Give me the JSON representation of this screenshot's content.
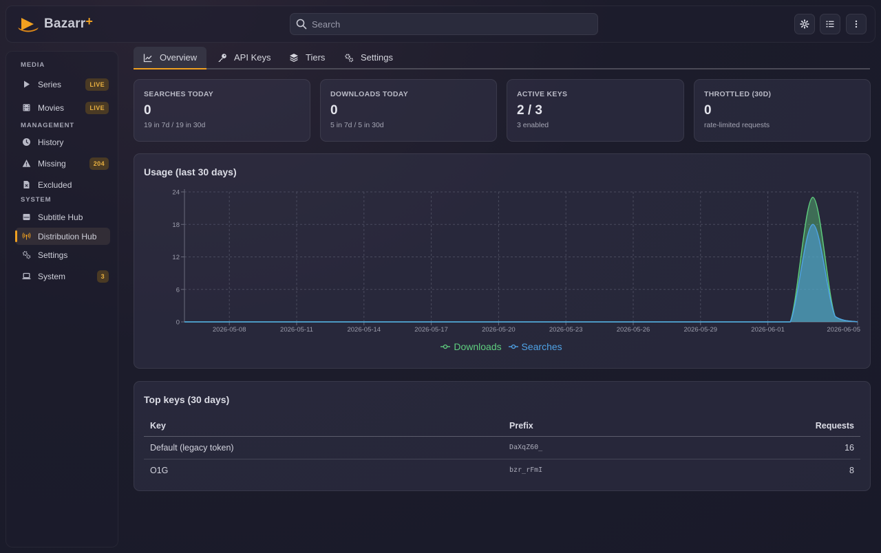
{
  "app": {
    "name": "Bazarr",
    "plus": "+"
  },
  "search": {
    "placeholder": "Search"
  },
  "toolbar": {
    "icons": [
      "settings-icon",
      "list-icon",
      "more-vertical-icon"
    ]
  },
  "sidebar": {
    "sections": [
      {
        "title": "MEDIA"
      },
      {
        "title": "MANAGEMENT"
      },
      {
        "title": "SYSTEM"
      }
    ],
    "items": [
      {
        "label": "Series",
        "icon": "play-icon",
        "badge": "LIVE"
      },
      {
        "label": "Movies",
        "icon": "film-icon",
        "badge": "LIVE"
      },
      {
        "label": "History",
        "icon": "clock-icon",
        "badge": ""
      },
      {
        "label": "Missing",
        "icon": "warning-icon",
        "badge": "204"
      },
      {
        "label": "Excluded",
        "icon": "file-excluded-icon",
        "badge": ""
      },
      {
        "label": "Subtitle Hub",
        "icon": "inbox-icon",
        "badge": ""
      },
      {
        "label": "Distribution Hub",
        "icon": "broadcast-icon",
        "badge": "",
        "active": true
      },
      {
        "label": "Settings",
        "icon": "cogs-icon",
        "badge": ""
      },
      {
        "label": "System",
        "icon": "laptop-icon",
        "badge": "3"
      }
    ]
  },
  "tabs": [
    {
      "label": "Overview",
      "icon": "chart-line-icon",
      "active": true
    },
    {
      "label": "API Keys",
      "icon": "key-icon"
    },
    {
      "label": "Tiers",
      "icon": "layers-icon"
    },
    {
      "label": "Settings",
      "icon": "cogs-icon"
    }
  ],
  "stats": [
    {
      "label": "SEARCHES TODAY",
      "value": "0",
      "sub": "19 in 7d / 19 in 30d"
    },
    {
      "label": "DOWNLOADS TODAY",
      "value": "0",
      "sub": "5 in 7d / 5 in 30d"
    },
    {
      "label": "ACTIVE KEYS",
      "value": "2 / 3",
      "sub": "3 enabled"
    },
    {
      "label": "THROTTLED (30D)",
      "value": "0",
      "sub": "rate-limited requests"
    }
  ],
  "usage_title": "Usage (last 30 days)",
  "colors": {
    "accent": "#f0a020",
    "downloads": "#5fcf7f",
    "searches": "#4fa3e6"
  },
  "chart_data": {
    "type": "area",
    "title": "Usage (last 30 days)",
    "x_tick_labels": [
      "2026-05-08",
      "2026-05-11",
      "2026-05-14",
      "2026-05-17",
      "2026-05-20",
      "2026-05-23",
      "2026-05-26",
      "2026-05-29",
      "2026-06-01",
      "2026-06-05"
    ],
    "y_ticks": [
      0,
      6,
      12,
      18,
      24
    ],
    "ylim": [
      0,
      24
    ],
    "x_days": [
      "2026-05-06",
      "2026-05-07",
      "2026-05-08",
      "2026-05-09",
      "2026-05-10",
      "2026-05-11",
      "2026-05-12",
      "2026-05-13",
      "2026-05-14",
      "2026-05-15",
      "2026-05-16",
      "2026-05-17",
      "2026-05-18",
      "2026-05-19",
      "2026-05-20",
      "2026-05-21",
      "2026-05-22",
      "2026-05-23",
      "2026-05-24",
      "2026-05-25",
      "2026-05-26",
      "2026-05-27",
      "2026-05-28",
      "2026-05-29",
      "2026-05-30",
      "2026-05-31",
      "2026-06-01",
      "2026-06-02",
      "2026-06-03",
      "2026-06-04",
      "2026-06-05"
    ],
    "series": [
      {
        "name": "Downloads",
        "color": "#5fcf7f",
        "values": [
          0,
          0,
          0,
          0,
          0,
          0,
          0,
          0,
          0,
          0,
          0,
          0,
          0,
          0,
          0,
          0,
          0,
          0,
          0,
          0,
          0,
          0,
          0,
          0,
          0,
          0,
          0,
          0,
          23,
          1,
          0
        ]
      },
      {
        "name": "Searches",
        "color": "#4fa3e6",
        "values": [
          0,
          0,
          0,
          0,
          0,
          0,
          0,
          0,
          0,
          0,
          0,
          0,
          0,
          0,
          0,
          0,
          0,
          0,
          0,
          0,
          0,
          0,
          0,
          0,
          0,
          0,
          0,
          0,
          18,
          1,
          0
        ]
      }
    ],
    "grid": true,
    "legend": "bottom-center"
  },
  "top_keys": {
    "title": "Top keys (30 days)",
    "columns": [
      "Key",
      "Prefix",
      "Requests"
    ],
    "rows": [
      {
        "key": "Default (legacy token)",
        "prefix": "DaXqZ60_",
        "requests": "16"
      },
      {
        "key": "O1G",
        "prefix": "bzr_rFmI",
        "requests": "8"
      }
    ]
  }
}
